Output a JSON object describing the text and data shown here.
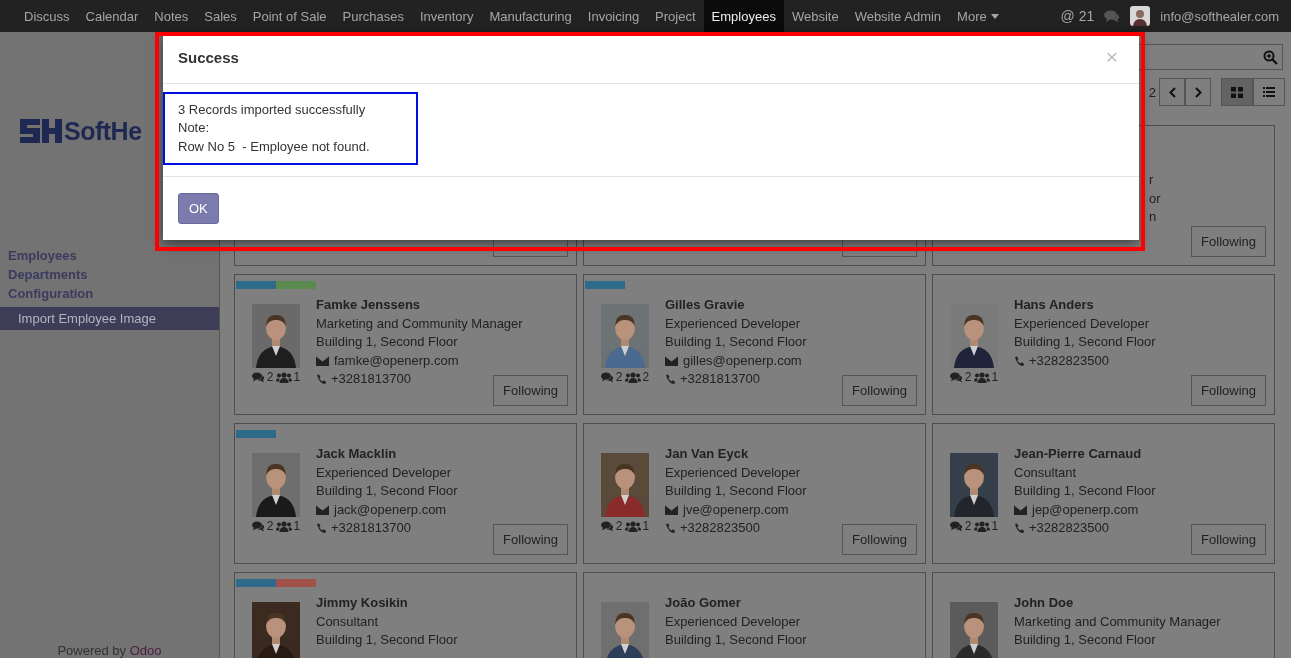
{
  "navbar": {
    "apps": [
      {
        "label": "Discuss",
        "selected": false
      },
      {
        "label": "Calendar",
        "selected": false
      },
      {
        "label": "Notes",
        "selected": false
      },
      {
        "label": "Sales",
        "selected": false
      },
      {
        "label": "Point of Sale",
        "selected": false
      },
      {
        "label": "Purchases",
        "selected": false
      },
      {
        "label": "Inventory",
        "selected": false
      },
      {
        "label": "Manufacturing",
        "selected": false
      },
      {
        "label": "Invoicing",
        "selected": false
      },
      {
        "label": "Project",
        "selected": false
      },
      {
        "label": "Employees",
        "selected": true
      },
      {
        "label": "Website",
        "selected": false
      },
      {
        "label": "Website Admin",
        "selected": false
      }
    ],
    "more": "More",
    "mention_symbol": "@",
    "mention_count": "21",
    "user": "info@softhealer.com"
  },
  "sidebar": {
    "logo_text": "SoftHe",
    "items": [
      {
        "label": "Employees",
        "selected": false,
        "kind": "header"
      },
      {
        "label": "Departments",
        "selected": false,
        "kind": "header"
      },
      {
        "label": "Configuration",
        "selected": false,
        "kind": "header"
      },
      {
        "label": "Import Employee Image",
        "selected": true,
        "kind": "sub"
      }
    ],
    "footer_text": "Powered by",
    "footer_link": "Odoo"
  },
  "control_panel": {
    "pager": "2",
    "views": [
      {
        "kind": "kanban",
        "selected": true
      },
      {
        "kind": "list",
        "selected": false
      }
    ]
  },
  "kanban": [
    {
      "kind": "hidden"
    },
    {
      "kind": "hidden"
    },
    {
      "kind": "hidden",
      "follow": "Following",
      "fragments": [
        "r",
        "or",
        "n"
      ]
    },
    {
      "kind": "card",
      "tags": [
        {
          "color": "#2e6a8a"
        },
        {
          "color": "#5a8a4e"
        }
      ],
      "name": "Famke Jenssens",
      "job": "Marketing and Community Manager",
      "location": "Building 1, Second Floor",
      "email": "famke@openerp.com",
      "phone": "+3281813700",
      "messages": "2",
      "followers": "1",
      "follow": "Following"
    },
    {
      "kind": "card",
      "tags": [
        {
          "color": "#2e6a8a"
        }
      ],
      "name": "Gilles Gravie",
      "job": "Experienced Developer",
      "location": "Building 1, Second Floor",
      "email": "gilles@openerp.com",
      "phone": "+3281813700",
      "messages": "2",
      "followers": "2",
      "follow": "Following"
    },
    {
      "kind": "card",
      "name": "Hans Anders",
      "job": "Experienced Developer",
      "location": "Building 1, Second Floor",
      "phone": "+3282823500",
      "messages": "2",
      "followers": "1",
      "follow": "Following"
    },
    {
      "kind": "card",
      "tags": [
        {
          "color": "#2e6a8a"
        }
      ],
      "name": "Jack Macklin",
      "job": "Experienced Developer",
      "location": "Building 1, Second Floor",
      "email": "jack@openerp.com",
      "phone": "+3281813700",
      "messages": "2",
      "followers": "1",
      "follow": "Following"
    },
    {
      "kind": "card",
      "name": "Jan Van Eyck",
      "job": "Experienced Developer",
      "location": "Building 1, Second Floor",
      "email": "jve@openerp.com",
      "phone": "+3282823500",
      "messages": "2",
      "followers": "1",
      "follow": "Following"
    },
    {
      "kind": "card",
      "name": "Jean-Pierre Carnaud",
      "job": "Consultant",
      "location": "Building 1, Second Floor",
      "email": "jep@openerp.com",
      "phone": "+3282823500",
      "messages": "2",
      "followers": "1",
      "follow": "Following"
    },
    {
      "kind": "card",
      "tags": [
        {
          "color": "#2e6a8a"
        },
        {
          "color": "#a0524a"
        }
      ],
      "name": "Jimmy Kosikin",
      "job": "Consultant",
      "location": "Building 1, Second Floor"
    },
    {
      "kind": "card",
      "name": "João Gomer",
      "job": "Experienced Developer",
      "location": "Building 1, Second Floor"
    },
    {
      "kind": "card",
      "name": "John Doe",
      "job": "Marketing and Community Manager",
      "location": "Building 1, Second Floor"
    }
  ],
  "dialog": {
    "title": "Success",
    "close": "×",
    "lines": [
      "3 Records imported successfully",
      "Note:",
      "Row No 5  - Employee not found."
    ],
    "ok": "OK"
  }
}
